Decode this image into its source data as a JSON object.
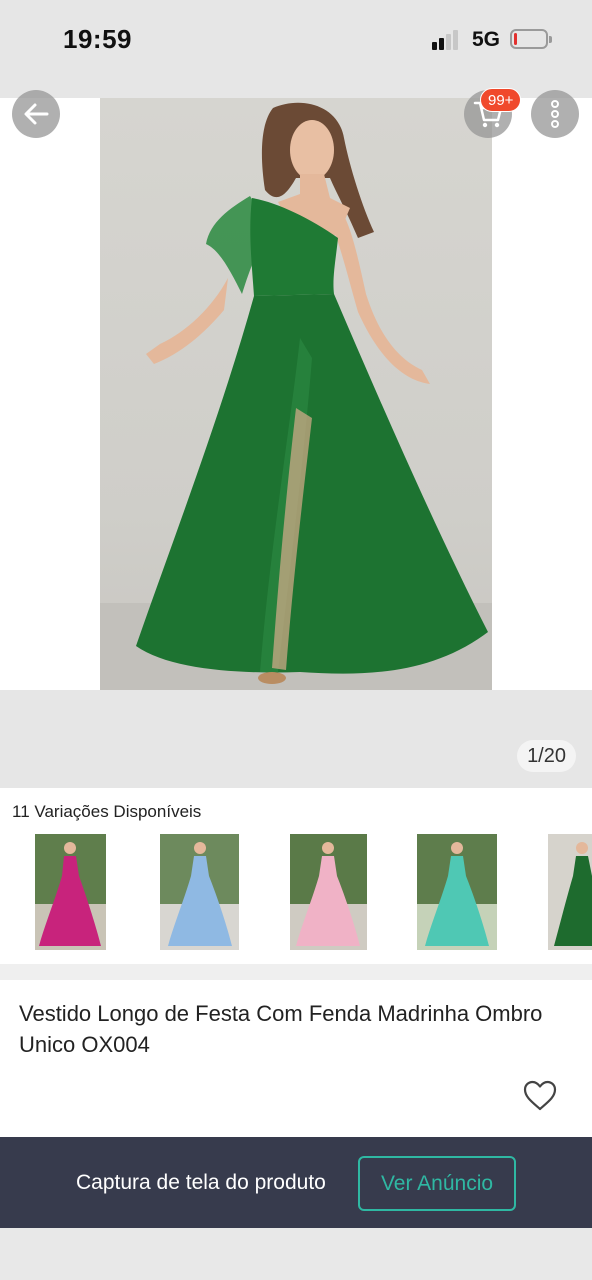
{
  "status_bar": {
    "time": "19:59",
    "network": "5G",
    "battery_level": 0.1
  },
  "nav": {
    "back_icon": "arrow-left-icon",
    "cart_icon": "cart-icon",
    "cart_badge": "99+",
    "more_icon": "vertical-dots-icon"
  },
  "gallery": {
    "counter": "1/20"
  },
  "variations": {
    "title": "11 Variações Disponíveis",
    "items": [
      {
        "color": "#c8237c"
      },
      {
        "color": "#8fb9e3"
      },
      {
        "color": "#f0b2c6"
      },
      {
        "color": "#4fc8b4"
      },
      {
        "color": "#1e6b2e"
      }
    ]
  },
  "product": {
    "title": "Vestido Longo de Festa Com Fenda Madrinha Ombro Unico OX004",
    "favorite_icon": "heart-icon"
  },
  "bottom_bar": {
    "capture_label": "Captura de tela do produto",
    "ad_button": "Ver Anúncio"
  },
  "colors": {
    "accent": "#2fb8a3",
    "bottom_bar_bg": "#373b4d",
    "badge": "#f0492c",
    "dress": "#1f7a34"
  }
}
